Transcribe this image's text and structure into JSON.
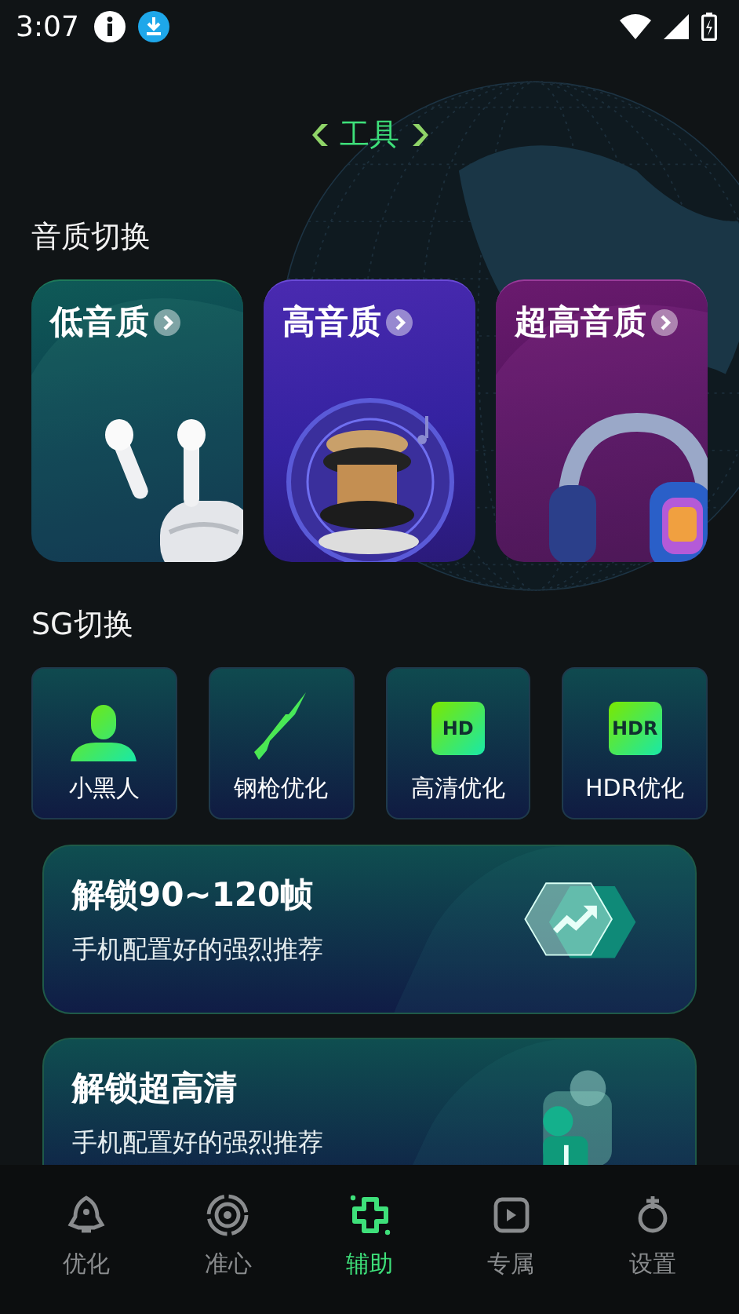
{
  "status_bar": {
    "time": "3:07"
  },
  "header": {
    "title": "工具"
  },
  "sound_quality": {
    "title": "音质切换",
    "cards": [
      {
        "label": "低音质",
        "kind": "earbuds"
      },
      {
        "label": "高音质",
        "kind": "speaker"
      },
      {
        "label": "超高音质",
        "kind": "headphones"
      }
    ]
  },
  "sg": {
    "title": "SG切换",
    "tiles": [
      {
        "label": "小黑人",
        "kind": "person"
      },
      {
        "label": "钢枪优化",
        "kind": "rifle"
      },
      {
        "label": "高清优化",
        "kind": "badge",
        "badge": "HD"
      },
      {
        "label": "HDR优化",
        "kind": "badge",
        "badge": "HDR"
      }
    ]
  },
  "unlock_cards": [
    {
      "title": "解锁90~120帧",
      "subtitle": "手机配置好的强烈推荐",
      "kind": "trend"
    },
    {
      "title": "解锁超高清",
      "subtitle": "手机配置好的强烈推荐",
      "kind": "pin"
    }
  ],
  "nav": [
    {
      "label": "优化",
      "kind": "rocket",
      "selected": false
    },
    {
      "label": "准心",
      "kind": "crosshair",
      "selected": false
    },
    {
      "label": "辅助",
      "kind": "plus",
      "selected": true
    },
    {
      "label": "专属",
      "kind": "frame",
      "selected": false
    },
    {
      "label": "设置",
      "kind": "gear",
      "selected": false
    }
  ]
}
